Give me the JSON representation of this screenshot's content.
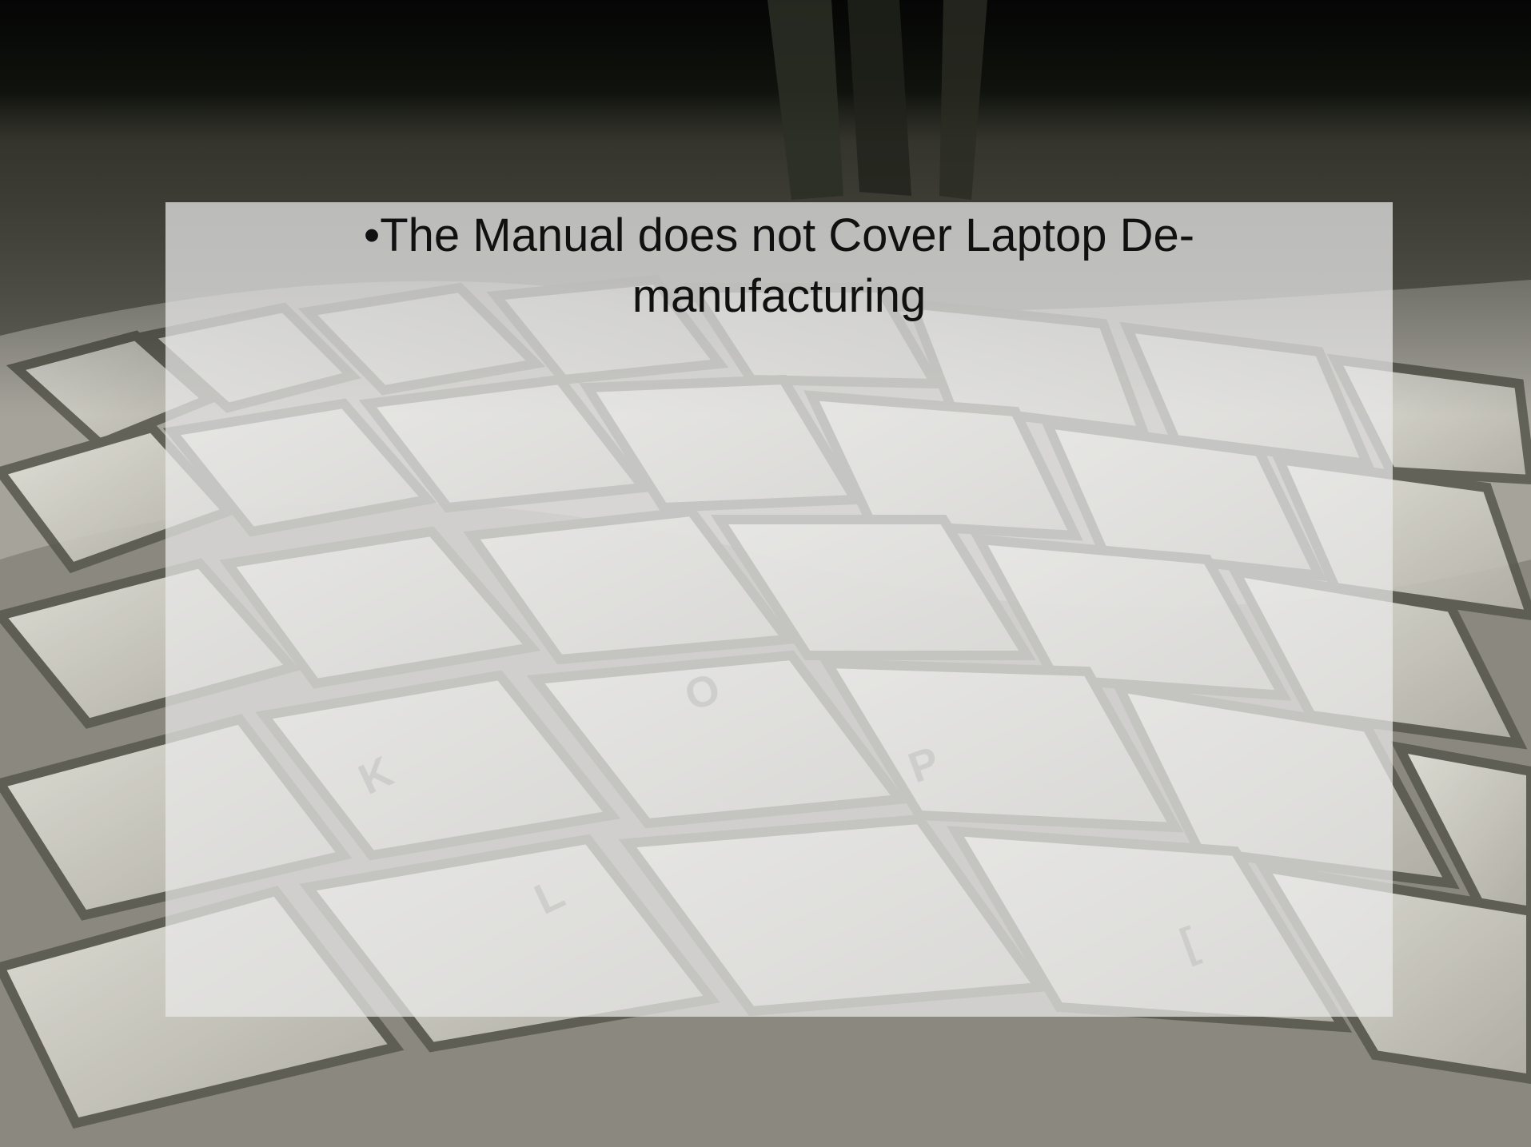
{
  "slide": {
    "background_description_icon": "keyboard-photo",
    "bullet": "•The Manual does not Cover Laptop De-",
    "bullet_continuation": "manufacturing"
  },
  "colors": {
    "panel": "#e8e8e8",
    "text": "#111111",
    "background_dark": "#0b0c09"
  }
}
